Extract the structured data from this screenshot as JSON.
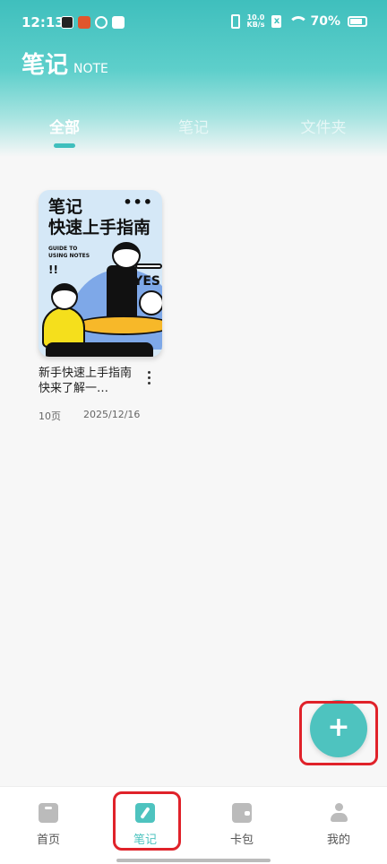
{
  "status_bar": {
    "time": "12:13",
    "net_speed_top": "10.0",
    "net_speed_bottom": "KB/s",
    "battery_percent": "70%"
  },
  "header": {
    "title": "笔记",
    "subtitle": "NOTE"
  },
  "tabs": [
    {
      "label": "全部",
      "active": true
    },
    {
      "label": "笔记",
      "active": false
    },
    {
      "label": "文件夹",
      "active": false
    }
  ],
  "notes": [
    {
      "cover_title_line1": "笔记",
      "cover_title_line2": "快速上手指南",
      "cover_subtitle_line1": "GUIDE TO",
      "cover_subtitle_line2": "USING NOTES",
      "cover_excl": "!!",
      "cover_yes": "YES",
      "cover_more": "•••",
      "name": "新手快速上手指南快来了解一…",
      "pages": "10页",
      "date": "2025/12/16"
    }
  ],
  "fab": {
    "label": "+"
  },
  "bottom_nav": [
    {
      "label": "首页",
      "icon": "home-icon",
      "active": false
    },
    {
      "label": "笔记",
      "icon": "note-icon",
      "active": true
    },
    {
      "label": "卡包",
      "icon": "wallet-icon",
      "active": false
    },
    {
      "label": "我的",
      "icon": "user-icon",
      "active": false
    }
  ],
  "colors": {
    "accent": "#4ec3bf",
    "header_gradient_top": "#3fbfbd",
    "highlight": "#e0222a"
  }
}
